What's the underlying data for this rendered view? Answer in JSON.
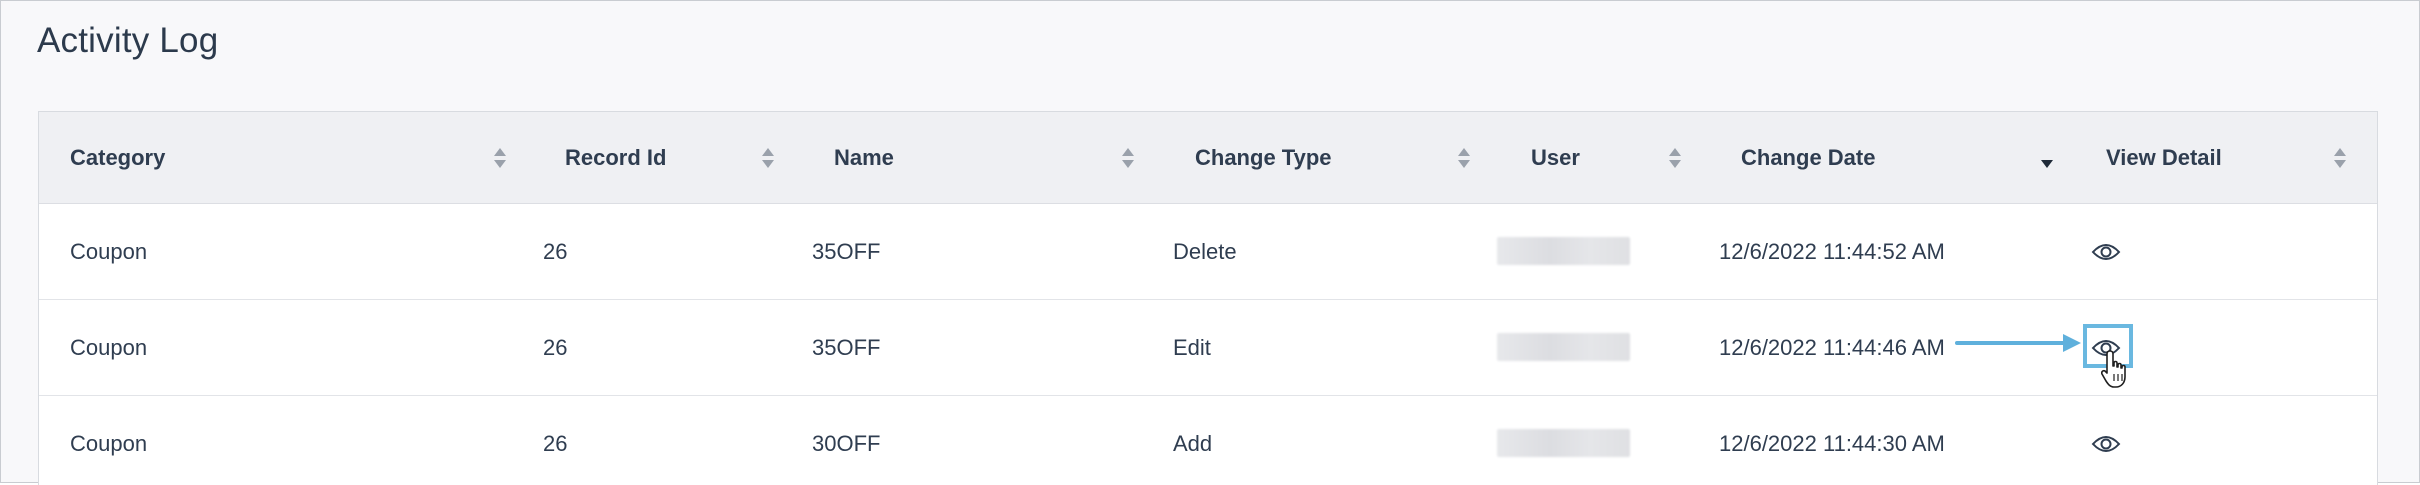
{
  "page": {
    "title": "Activity Log"
  },
  "colors": {
    "accent": "#6ab8e0",
    "text": "#2f3d50",
    "header_bg": "#eff0f3"
  },
  "table": {
    "columns": [
      {
        "label": "Category",
        "sort": "both"
      },
      {
        "label": "Record Id",
        "sort": "both"
      },
      {
        "label": "Name",
        "sort": "both"
      },
      {
        "label": "Change Type",
        "sort": "both"
      },
      {
        "label": "User",
        "sort": "both"
      },
      {
        "label": "Change Date",
        "sort": "desc"
      },
      {
        "label": "View Detail",
        "sort": "both"
      }
    ],
    "rows": [
      {
        "category": "Coupon",
        "record_id": "26",
        "name": "35OFF",
        "change_type": "Delete",
        "change_date": "12/6/2022 11:44:52 AM",
        "detail_icon": "eye-icon"
      },
      {
        "category": "Coupon",
        "record_id": "26",
        "name": "35OFF",
        "change_type": "Edit",
        "change_date": "12/6/2022 11:44:46 AM",
        "detail_icon": "eye-icon"
      },
      {
        "category": "Coupon",
        "record_id": "26",
        "name": "30OFF",
        "change_type": "Add",
        "change_date": "12/6/2022 11:44:30 AM",
        "detail_icon": "eye-icon"
      }
    ]
  }
}
